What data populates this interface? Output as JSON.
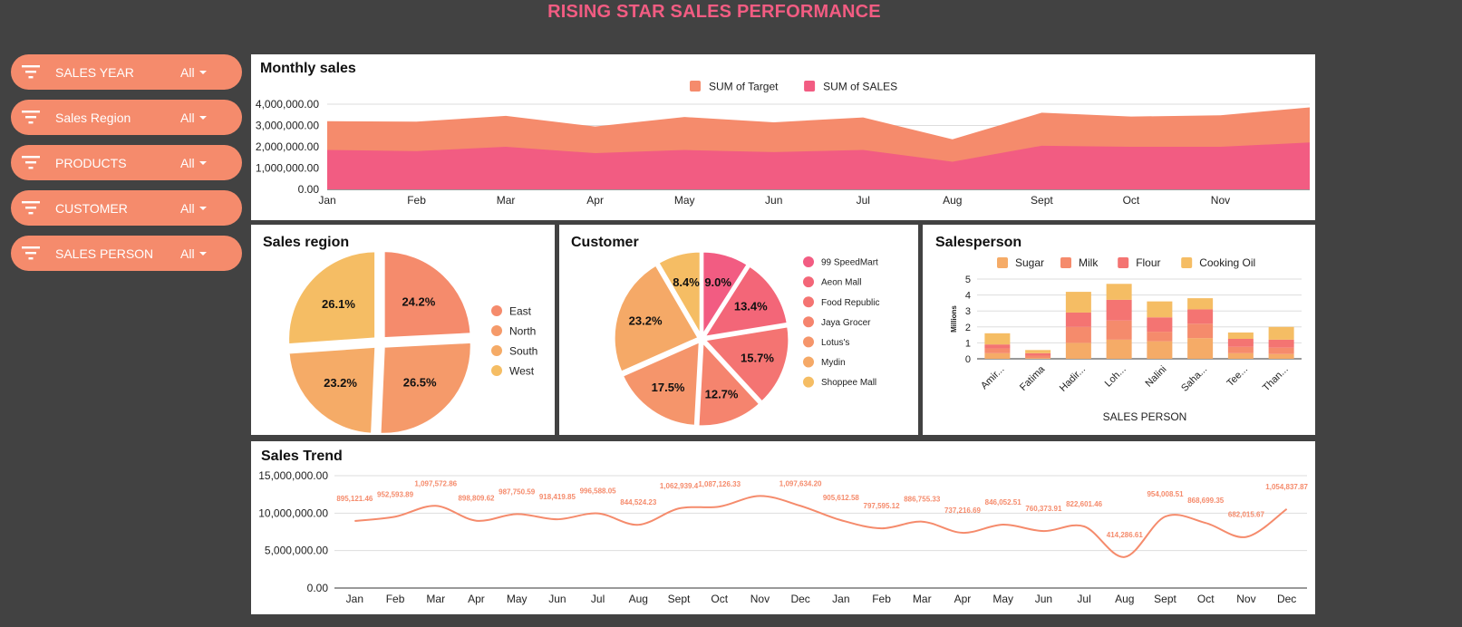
{
  "title": "RISING STAR SALES PERFORMANCE",
  "colors": {
    "background": "#424242",
    "title": "#f25c82",
    "filter_bg": "#f58b6c",
    "target": "#f58b6c",
    "sales": "#f25c82",
    "trend_line": "#f58b6c"
  },
  "filters": [
    {
      "label": "SALES YEAR",
      "value": "All",
      "icon": "filter-icon"
    },
    {
      "label": "Sales Region",
      "value": "All",
      "icon": "filter-icon"
    },
    {
      "label": "PRODUCTS",
      "value": "All",
      "icon": "filter-icon"
    },
    {
      "label": "CUSTOMER",
      "value": "All",
      "icon": "filter-icon"
    },
    {
      "label": "SALES PERSON",
      "value": "All",
      "icon": "filter-icon"
    }
  ],
  "panels": {
    "monthly": "Monthly sales",
    "region": "Sales region",
    "customer": "Customer",
    "salesperson": "Salesperson",
    "trend": "Sales Trend"
  },
  "chart_data": [
    {
      "id": "monthly",
      "type": "area",
      "title": "Monthly sales",
      "categories": [
        "Jan",
        "Feb",
        "Mar",
        "Apr",
        "May",
        "Jun",
        "Jul",
        "Aug",
        "Sept",
        "Oct",
        "Nov",
        ""
      ],
      "series": [
        {
          "name": "SUM of Target",
          "color": "#f58b6c",
          "values": [
            3200000,
            3180000,
            3450000,
            2950000,
            3400000,
            3150000,
            3380000,
            2350000,
            3600000,
            3420000,
            3480000,
            3850000
          ]
        },
        {
          "name": "SUM of SALES",
          "color": "#f25c82",
          "values": [
            1850000,
            1800000,
            2000000,
            1700000,
            1850000,
            1750000,
            1850000,
            1300000,
            2050000,
            2000000,
            2000000,
            2200000
          ]
        }
      ],
      "yticks": [
        "0.00",
        "1,000,000.00",
        "2,000,000.00",
        "3,000,000.00",
        "4,000,000.00"
      ],
      "ylim": [
        0,
        4000000
      ],
      "grid": true,
      "legend": "top"
    },
    {
      "id": "region",
      "type": "pie",
      "title": "Sales region",
      "slices": [
        {
          "label": "East",
          "value": 24.2,
          "text": "24.2%",
          "color": "#f58b6c"
        },
        {
          "label": "North",
          "value": 26.5,
          "text": "26.5%",
          "color": "#f59a6a"
        },
        {
          "label": "South",
          "value": 23.2,
          "text": "23.2%",
          "color": "#f5ab67"
        },
        {
          "label": "West",
          "value": 26.1,
          "text": "26.1%",
          "color": "#f5bd64"
        }
      ],
      "legend": "right"
    },
    {
      "id": "customer",
      "type": "pie",
      "title": "Customer",
      "slices": [
        {
          "label": "99 SpeedMart",
          "value": 9.0,
          "text": "9.0%",
          "color": "#f25c82"
        },
        {
          "label": "Aeon Mall",
          "value": 13.4,
          "text": "13.4%",
          "color": "#f36678"
        },
        {
          "label": "Food Republic",
          "value": 15.7,
          "text": "15.7%",
          "color": "#f47472"
        },
        {
          "label": "Jaya Grocer",
          "value": 12.7,
          "text": "12.7%",
          "color": "#f5846e"
        },
        {
          "label": "Lotus's",
          "value": 17.5,
          "text": "17.5%",
          "color": "#f5956b"
        },
        {
          "label": "Mydin",
          "value": 23.2,
          "text": "23.2%",
          "color": "#f5a967"
        },
        {
          "label": "Shoppee Mall",
          "value": 8.4,
          "text": "8.4%",
          "color": "#f5bd64"
        }
      ],
      "legend": "right"
    },
    {
      "id": "salesperson",
      "type": "bar",
      "title": "Salesperson",
      "stacked": true,
      "categories": [
        "Amir...",
        "Fatima",
        "Hadir...",
        "Loh...",
        "Nalini",
        "Saha...",
        "Tee...",
        "Than..."
      ],
      "series": [
        {
          "name": "Sugar",
          "color": "#f5ab67",
          "values": [
            0.35,
            0.05,
            1.0,
            1.2,
            1.1,
            1.3,
            0.35,
            0.3
          ]
        },
        {
          "name": "Milk",
          "color": "#f58b6c",
          "values": [
            0.3,
            0.15,
            1.0,
            1.2,
            0.6,
            0.9,
            0.4,
            0.4
          ]
        },
        {
          "name": "Flour",
          "color": "#f47472",
          "values": [
            0.25,
            0.15,
            0.9,
            1.3,
            0.9,
            0.9,
            0.5,
            0.5
          ]
        },
        {
          "name": "Cooking Oil",
          "color": "#f5bd64",
          "values": [
            0.7,
            0.2,
            1.3,
            1.0,
            1.0,
            0.7,
            0.4,
            0.8
          ]
        }
      ],
      "ylabel": "Millions",
      "xlabel": "SALES PERSON",
      "yticks": [
        "0",
        "1",
        "2",
        "3",
        "4",
        "5"
      ],
      "ylim": [
        0,
        5
      ],
      "legend": "top"
    },
    {
      "id": "trend",
      "type": "line",
      "title": "Sales Trend",
      "categories": [
        "Jan",
        "Feb",
        "Mar",
        "Apr",
        "May",
        "Jun",
        "Jul",
        "Aug",
        "Sept",
        "Oct",
        "Nov",
        "Dec",
        "Jan",
        "Feb",
        "Mar",
        "Apr",
        "May",
        "Jun",
        "Jul",
        "Aug",
        "Sept",
        "Oct",
        "Nov",
        "Dec"
      ],
      "values": [
        895121.46,
        952593.89,
        1097572.86,
        898809.62,
        987750.59,
        918419.85,
        996588.05,
        844524.23,
        1062939.4,
        1087126.33,
        1230000,
        1097634.2,
        905612.58,
        797595.12,
        886755.33,
        737216.69,
        846052.51,
        760373.91,
        822601.46,
        414286.61,
        954008.51,
        868699.35,
        682015.67,
        1054837.87
      ],
      "labels": [
        "895,121.46",
        "952,593.89",
        "1,097,572.86",
        "898,809.62",
        "987,750.59",
        "918,419.85",
        "996,588.05",
        "844,524.23",
        "1,062,939.4",
        "1,087,126.33",
        "",
        "1,097,634.20",
        "905,612.58",
        "797,595.12",
        "886,755.33",
        "737,216.69",
        "846,052.51",
        "760,373.91",
        "822,601.46",
        "414,286.61",
        "954,008.51",
        "868,699.35",
        "682,015.67",
        "1,054,837.87"
      ],
      "plot_scale": 10,
      "yticks": [
        "0.00",
        "5,000,000.00",
        "10,000,000.00",
        "15,000,000.00"
      ],
      "ylim": [
        0,
        15000000
      ],
      "grid": true
    }
  ]
}
